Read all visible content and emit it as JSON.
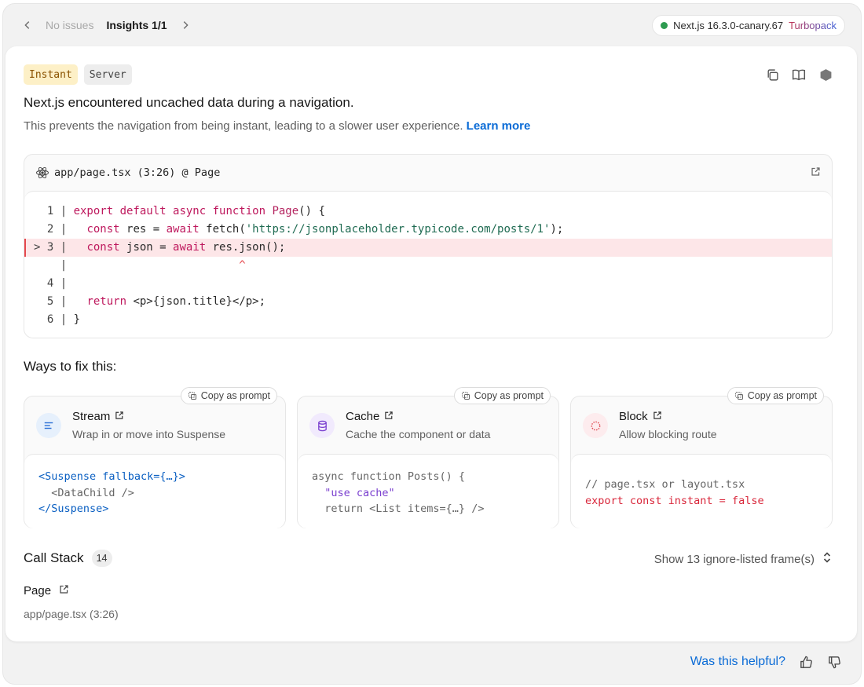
{
  "nav": {
    "issues_label": "No issues",
    "insights_label": "Insights 1/1",
    "prev_icon": "chevron-left-icon",
    "next_icon": "chevron-right-icon"
  },
  "version": {
    "label": "Next.js 16.3.0-canary.67",
    "bundler": "Turbopack",
    "status_color": "#2e9b50"
  },
  "error": {
    "badges": [
      "Instant",
      "Server"
    ],
    "title": "Next.js encountered uncached data during a navigation.",
    "description": "This prevents the navigation from being instant, leading to a slower user experience.",
    "learn_more": "Learn more"
  },
  "code_frame": {
    "file_label": "app/page.tsx (3:26) @ Page"
  },
  "ways_to_fix": {
    "title": "Ways to fix this:",
    "copy_label": "Copy as prompt",
    "options": [
      {
        "name": "Stream",
        "description": "Wrap in or move into Suspense"
      },
      {
        "name": "Cache",
        "description": "Cache the component or data"
      },
      {
        "name": "Block",
        "description": "Allow blocking route"
      }
    ]
  },
  "call_stack": {
    "title": "Call Stack",
    "count": "14",
    "toggle_label": "Show 13 ignore-listed frame(s)",
    "frame_name": "Page",
    "frame_location": "app/page.tsx (3:26)"
  },
  "feedback": {
    "question": "Was this helpful?"
  },
  "colors": {
    "accent": "#0a6bd6",
    "error_highlight": "#fde6e8",
    "instant_badge": "#fdf0c7"
  }
}
